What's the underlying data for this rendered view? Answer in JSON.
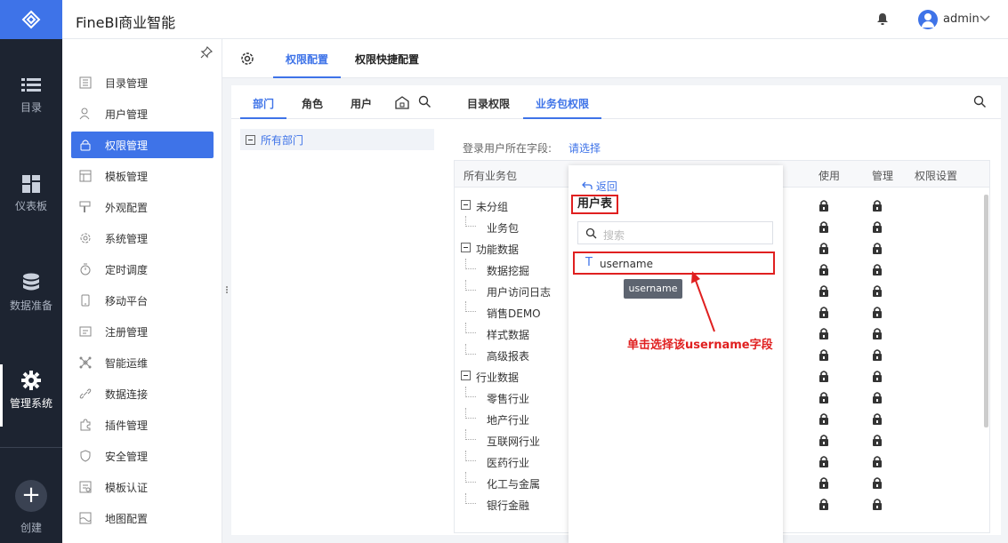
{
  "app": {
    "title": "FineBI商业智能",
    "user": "admin"
  },
  "rail": {
    "items": [
      {
        "label": "目录",
        "icon": "list-icon"
      },
      {
        "label": "仪表板",
        "icon": "dashboard-icon"
      },
      {
        "label": "数据准备",
        "icon": "database-icon"
      },
      {
        "label": "管理系统",
        "icon": "gear-icon",
        "active": true
      }
    ],
    "create_label": "创建"
  },
  "menu": {
    "items": [
      "目录管理",
      "用户管理",
      "权限管理",
      "模板管理",
      "外观配置",
      "系统管理",
      "定时调度",
      "移动平台",
      "注册管理",
      "智能运维",
      "数据连接",
      "插件管理",
      "安全管理",
      "模板认证",
      "地图配置"
    ],
    "active_index": 2
  },
  "top_tabs": {
    "tab1": "权限配置",
    "tab2": "权限快捷配置"
  },
  "left_pane": {
    "tabs": {
      "dept": "部门",
      "role": "角色",
      "user": "用户"
    },
    "root": "所有部门"
  },
  "right_pane": {
    "tabs": {
      "catalog": "目录权限",
      "package": "业务包权限"
    },
    "field_label": "登录用户所在字段:",
    "field_select": "请选择",
    "columns": {
      "name": "所有业务包",
      "use": "使用",
      "manage": "管理",
      "settings": "权限设置"
    },
    "rows": [
      {
        "label": "未分组",
        "level": 0
      },
      {
        "label": "业务包",
        "level": 1
      },
      {
        "label": "功能数据",
        "level": 0
      },
      {
        "label": "数据挖掘",
        "level": 1
      },
      {
        "label": "用户访问日志",
        "level": 1
      },
      {
        "label": "销售DEMO",
        "level": 1
      },
      {
        "label": "样式数据",
        "level": 1
      },
      {
        "label": "高级报表",
        "level": 1
      },
      {
        "label": "行业数据",
        "level": 0
      },
      {
        "label": "零售行业",
        "level": 1
      },
      {
        "label": "地产行业",
        "level": 1
      },
      {
        "label": "互联网行业",
        "level": 1
      },
      {
        "label": "医药行业",
        "level": 1
      },
      {
        "label": "化工与金属",
        "level": 1
      },
      {
        "label": "银行金融",
        "level": 1
      }
    ]
  },
  "popup": {
    "back": "返回",
    "title": "用户表",
    "search_placeholder": "搜索",
    "field_type": "T",
    "field_name": "username",
    "tooltip": "username"
  },
  "annotation": "单击选择该username字段",
  "colors": {
    "accent": "#3e73e8",
    "rail": "#1d2431",
    "highlight": "#e02020"
  }
}
